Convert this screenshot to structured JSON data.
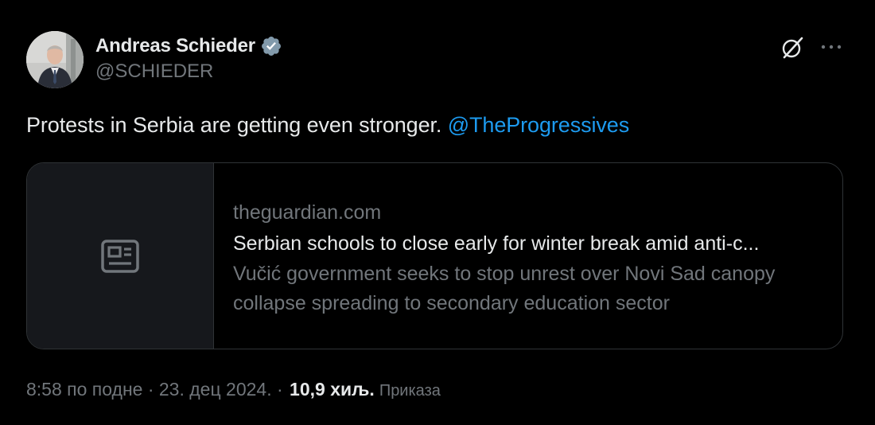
{
  "author": {
    "name": "Andreas Schieder",
    "handle": "@SCHIEDER"
  },
  "tweet": {
    "text": "Protests in Serbia are getting even stronger. ",
    "mention": "@TheProgressives"
  },
  "card": {
    "domain": "theguardian.com",
    "title": "Serbian schools to close early for winter break amid anti-c...",
    "description": "Vučić government seeks to stop unrest over Novi Sad canopy collapse spreading to secondary education sector"
  },
  "meta": {
    "timestamp": "8:58 по подне · 23. дец 2024.",
    "separator": " · ",
    "views_count": "10,9 хиљ.",
    "views_label": "Приказа"
  },
  "colors": {
    "background": "#000000",
    "text_primary": "#e7e9ea",
    "text_secondary": "#71767b",
    "accent": "#1d9bf0",
    "border": "#2f3336"
  },
  "icons": {
    "verified": "verified-badge-icon",
    "grok": "grok-icon",
    "more": "more-options-icon",
    "article": "article-icon"
  }
}
